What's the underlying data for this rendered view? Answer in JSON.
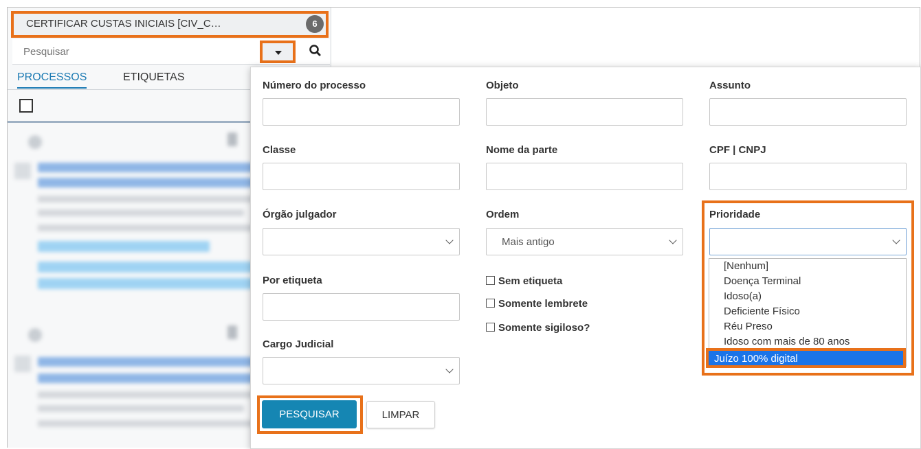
{
  "task": {
    "title": "CERTIFICAR CUSTAS INICIAIS [CIV_C…",
    "count": "6"
  },
  "search": {
    "placeholder": "Pesquisar"
  },
  "tabs": [
    {
      "label": "PROCESSOS"
    },
    {
      "label": "ETIQUETAS"
    }
  ],
  "form": {
    "numero_processo": {
      "label": "Número do processo",
      "value": ""
    },
    "objeto": {
      "label": "Objeto",
      "value": ""
    },
    "assunto": {
      "label": "Assunto",
      "value": ""
    },
    "classe": {
      "label": "Classe",
      "value": ""
    },
    "nome_parte": {
      "label": "Nome da parte",
      "value": ""
    },
    "cpf_cnpj": {
      "label": "CPF | CNPJ",
      "value": ""
    },
    "orgao_julgador": {
      "label": "Órgão julgador",
      "value": ""
    },
    "ordem": {
      "label": "Ordem",
      "value": "Mais antigo"
    },
    "prioridade": {
      "label": "Prioridade",
      "value": "",
      "options": [
        "[Nenhum]",
        "Doença Terminal",
        "Idoso(a)",
        "Deficiente Físico",
        "Réu Preso",
        "Idoso com mais de 80 anos",
        "Juízo 100% digital"
      ],
      "highlighted": "Juízo 100% digital"
    },
    "por_etiqueta": {
      "label": "Por etiqueta",
      "value": ""
    },
    "cargo_judicial": {
      "label": "Cargo Judicial",
      "value": ""
    },
    "checkboxes": [
      {
        "label": "Sem etiqueta",
        "checked": false
      },
      {
        "label": "Somente lembrete",
        "checked": false
      },
      {
        "label": "Somente sigiloso?",
        "checked": false
      }
    ]
  },
  "buttons": {
    "search": "PESQUISAR",
    "clear": "LIMPAR"
  },
  "colors": {
    "highlight": "#e8711a",
    "primary": "#1586b3",
    "link": "#1b7ab3",
    "selected_option": "#1a74e8"
  }
}
